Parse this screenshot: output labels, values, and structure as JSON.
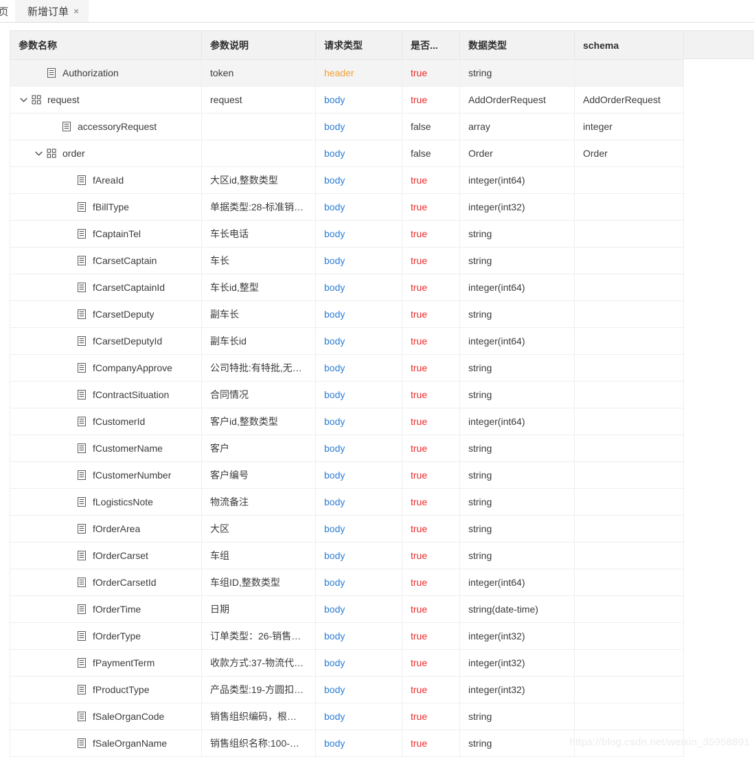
{
  "tabs": {
    "home_label": "页",
    "active_label": "新增订单",
    "close_glyph": "×"
  },
  "table": {
    "columns": [
      {
        "key": "name",
        "label": "参数名称"
      },
      {
        "key": "desc",
        "label": "参数说明"
      },
      {
        "key": "req",
        "label": "请求类型"
      },
      {
        "key": "need",
        "label": "是否..."
      },
      {
        "key": "dtype",
        "label": "数据类型"
      },
      {
        "key": "schema",
        "label": "schema"
      }
    ],
    "rows": [
      {
        "name": "Authorization",
        "icon": "file-icon",
        "expandable": false,
        "indent": 1,
        "shaded": true,
        "desc": "token",
        "req": "header",
        "need": "true",
        "dtype": "string",
        "schema": ""
      },
      {
        "name": "request",
        "icon": "grid-icon",
        "expandable": true,
        "indent": 0,
        "shaded": false,
        "desc": "request",
        "req": "body",
        "need": "true",
        "dtype": "AddOrderRequest",
        "schema": "AddOrderRequest"
      },
      {
        "name": "accessoryRequest",
        "icon": "file-icon",
        "expandable": false,
        "indent": 2,
        "shaded": false,
        "desc": "",
        "req": "body",
        "need": "false",
        "dtype": "array",
        "schema": "integer"
      },
      {
        "name": "order",
        "icon": "grid-icon",
        "expandable": true,
        "indent": 1,
        "shaded": false,
        "desc": "",
        "req": "body",
        "need": "false",
        "dtype": "Order",
        "schema": "Order"
      },
      {
        "name": "fAreaId",
        "icon": "file-icon",
        "expandable": false,
        "indent": 3,
        "shaded": false,
        "desc": "大区id,整数类型",
        "req": "body",
        "need": "true",
        "dtype": "integer(int64)",
        "schema": ""
      },
      {
        "name": "fBillType",
        "icon": "file-icon",
        "expandable": false,
        "indent": 3,
        "shaded": false,
        "desc": "单据类型:28-标准销…",
        "req": "body",
        "need": "true",
        "dtype": "integer(int32)",
        "schema": ""
      },
      {
        "name": "fCaptainTel",
        "icon": "file-icon",
        "expandable": false,
        "indent": 3,
        "shaded": false,
        "desc": "车长电话",
        "req": "body",
        "need": "true",
        "dtype": "string",
        "schema": ""
      },
      {
        "name": "fCarsetCaptain",
        "icon": "file-icon",
        "expandable": false,
        "indent": 3,
        "shaded": false,
        "desc": "车长",
        "req": "body",
        "need": "true",
        "dtype": "string",
        "schema": ""
      },
      {
        "name": "fCarsetCaptainId",
        "icon": "file-icon",
        "expandable": false,
        "indent": 3,
        "shaded": false,
        "desc": "车长id,整型",
        "req": "body",
        "need": "true",
        "dtype": "integer(int64)",
        "schema": ""
      },
      {
        "name": "fCarsetDeputy",
        "icon": "file-icon",
        "expandable": false,
        "indent": 3,
        "shaded": false,
        "desc": "副车长",
        "req": "body",
        "need": "true",
        "dtype": "string",
        "schema": ""
      },
      {
        "name": "fCarsetDeputyId",
        "icon": "file-icon",
        "expandable": false,
        "indent": 3,
        "shaded": false,
        "desc": "副车长id",
        "req": "body",
        "need": "true",
        "dtype": "integer(int64)",
        "schema": ""
      },
      {
        "name": "fCompanyApprove",
        "icon": "file-icon",
        "expandable": false,
        "indent": 3,
        "shaded": false,
        "desc": "公司特批:有特批,无…",
        "req": "body",
        "need": "true",
        "dtype": "string",
        "schema": ""
      },
      {
        "name": "fContractSituation",
        "icon": "file-icon",
        "expandable": false,
        "indent": 3,
        "shaded": false,
        "desc": "合同情况",
        "req": "body",
        "need": "true",
        "dtype": "string",
        "schema": ""
      },
      {
        "name": "fCustomerId",
        "icon": "file-icon",
        "expandable": false,
        "indent": 3,
        "shaded": false,
        "desc": "客户id,整数类型",
        "req": "body",
        "need": "true",
        "dtype": "integer(int64)",
        "schema": ""
      },
      {
        "name": "fCustomerName",
        "icon": "file-icon",
        "expandable": false,
        "indent": 3,
        "shaded": false,
        "desc": "客户",
        "req": "body",
        "need": "true",
        "dtype": "string",
        "schema": ""
      },
      {
        "name": "fCustomerNumber",
        "icon": "file-icon",
        "expandable": false,
        "indent": 3,
        "shaded": false,
        "desc": "客户编号",
        "req": "body",
        "need": "true",
        "dtype": "string",
        "schema": ""
      },
      {
        "name": "fLogisticsNote",
        "icon": "file-icon",
        "expandable": false,
        "indent": 3,
        "shaded": false,
        "desc": "物流备注",
        "req": "body",
        "need": "true",
        "dtype": "string",
        "schema": ""
      },
      {
        "name": "fOrderArea",
        "icon": "file-icon",
        "expandable": false,
        "indent": 3,
        "shaded": false,
        "desc": "大区",
        "req": "body",
        "need": "true",
        "dtype": "string",
        "schema": ""
      },
      {
        "name": "fOrderCarset",
        "icon": "file-icon",
        "expandable": false,
        "indent": 3,
        "shaded": false,
        "desc": "车组",
        "req": "body",
        "need": "true",
        "dtype": "string",
        "schema": ""
      },
      {
        "name": "fOrderCarsetId",
        "icon": "file-icon",
        "expandable": false,
        "indent": 3,
        "shaded": false,
        "desc": "车组ID,整数类型",
        "req": "body",
        "need": "true",
        "dtype": "integer(int64)",
        "schema": ""
      },
      {
        "name": "fOrderTime",
        "icon": "file-icon",
        "expandable": false,
        "indent": 3,
        "shaded": false,
        "desc": "日期",
        "req": "body",
        "need": "true",
        "dtype": "string(date-time)",
        "schema": ""
      },
      {
        "name": "fOrderType",
        "icon": "file-icon",
        "expandable": false,
        "indent": 3,
        "shaded": false,
        "desc": "订单类型：26-销售…",
        "req": "body",
        "need": "true",
        "dtype": "integer(int32)",
        "schema": ""
      },
      {
        "name": "fPaymentTerm",
        "icon": "file-icon",
        "expandable": false,
        "indent": 3,
        "shaded": false,
        "desc": "收款方式:37-物流代…",
        "req": "body",
        "need": "true",
        "dtype": "integer(int32)",
        "schema": ""
      },
      {
        "name": "fProductType",
        "icon": "file-icon",
        "expandable": false,
        "indent": 3,
        "shaded": false,
        "desc": "产品类型:19-方圆扣…",
        "req": "body",
        "need": "true",
        "dtype": "integer(int32)",
        "schema": ""
      },
      {
        "name": "fSaleOrganCode",
        "icon": "file-icon",
        "expandable": false,
        "indent": 3,
        "shaded": false,
        "desc": "销售组织编码，根…",
        "req": "body",
        "need": "true",
        "dtype": "string",
        "schema": ""
      },
      {
        "name": "fSaleOrganName",
        "icon": "file-icon",
        "expandable": false,
        "indent": 3,
        "shaded": false,
        "desc": "销售组织名称:100-…",
        "req": "body",
        "need": "true",
        "dtype": "string",
        "schema": ""
      }
    ]
  },
  "watermark": {
    "text": "https://blog.csdn.net/weixin_35958891"
  },
  "colors": {
    "header_type": "#f0a13c",
    "body_type": "#2d7dd2",
    "required_true": "#ee2a2a",
    "required_false": "#3b3b3b",
    "header_bg": "#f2f2f2",
    "border": "#ebeef2"
  }
}
